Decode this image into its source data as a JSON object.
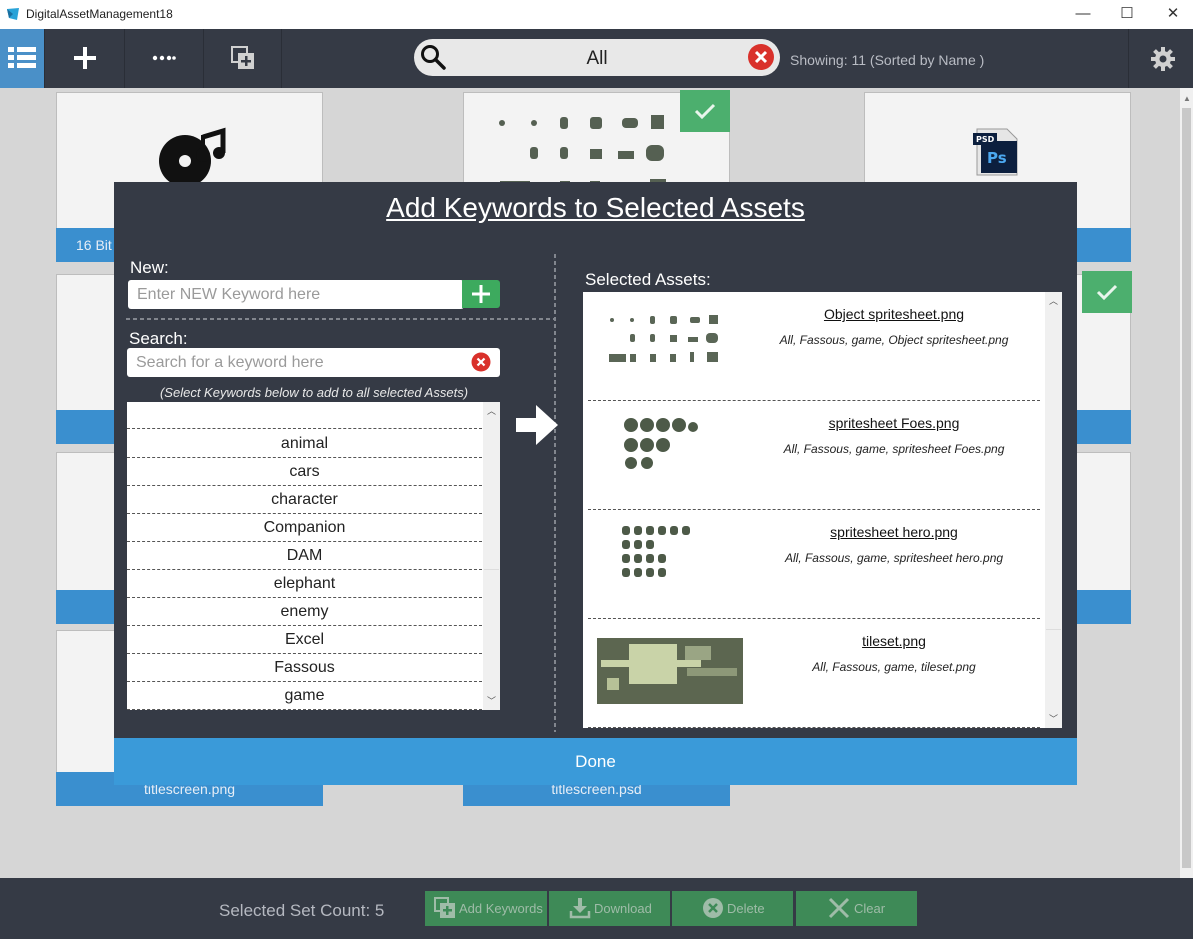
{
  "window": {
    "title": "DigitalAssetManagement18",
    "minimize": "—",
    "maximize": "☐",
    "close": "✕"
  },
  "toolbar": {
    "search_value": "All",
    "showing": "Showing: 11 (Sorted by Name )"
  },
  "gallery": {
    "cards": [
      {
        "label": "16 Bit"
      },
      {
        "label": "titlescreen.png"
      },
      {
        "label": "titlescreen.psd"
      }
    ],
    "psd_badge": "PSD",
    "ps_label": "Ps"
  },
  "modal": {
    "title": "Add Keywords to Selected Assets",
    "new_label": "New:",
    "new_placeholder": "Enter NEW Keyword here",
    "search_label": "Search:",
    "search_placeholder": "Search for a keyword here",
    "hint": "(Select Keywords below to add to all selected Assets)",
    "selected_label": "Selected Assets:",
    "keywords": [
      "",
      "animal",
      "cars",
      "character",
      "Companion",
      "DAM",
      "elephant",
      "enemy",
      "Excel",
      "Fassous",
      "game"
    ],
    "assets": [
      {
        "name": "Object spritesheet.png",
        "keywords": "All, Fassous, game, Object spritesheet.png"
      },
      {
        "name": "spritesheet Foes.png",
        "keywords": "All, Fassous, game, spritesheet Foes.png"
      },
      {
        "name": "spritesheet hero.png",
        "keywords": "All, Fassous, game, spritesheet hero.png"
      },
      {
        "name": "tileset.png",
        "keywords": "All, Fassous, game, tileset.png"
      }
    ],
    "done_label": "Done"
  },
  "statusbar": {
    "selected_count": "Selected Set Count: 5",
    "add_keywords": "Add Keywords",
    "download": "Download",
    "delete": "Delete",
    "clear": "Clear"
  },
  "colors": {
    "toolbar_bg": "#353a45",
    "accent_blue": "#3a9ad9",
    "green": "#3daa5e",
    "close_red": "#d9312b"
  },
  "icons": [
    "list-icon",
    "plus-icon",
    "more-icon",
    "add-set-icon",
    "search-icon",
    "clear-search-icon",
    "gear-icon",
    "music-disc-icon",
    "photoshop-file-icon",
    "check-icon",
    "add-keyword-icon",
    "clear-keyword-search-icon",
    "arrow-right-icon",
    "download-icon",
    "delete-icon",
    "clear-x-icon"
  ]
}
